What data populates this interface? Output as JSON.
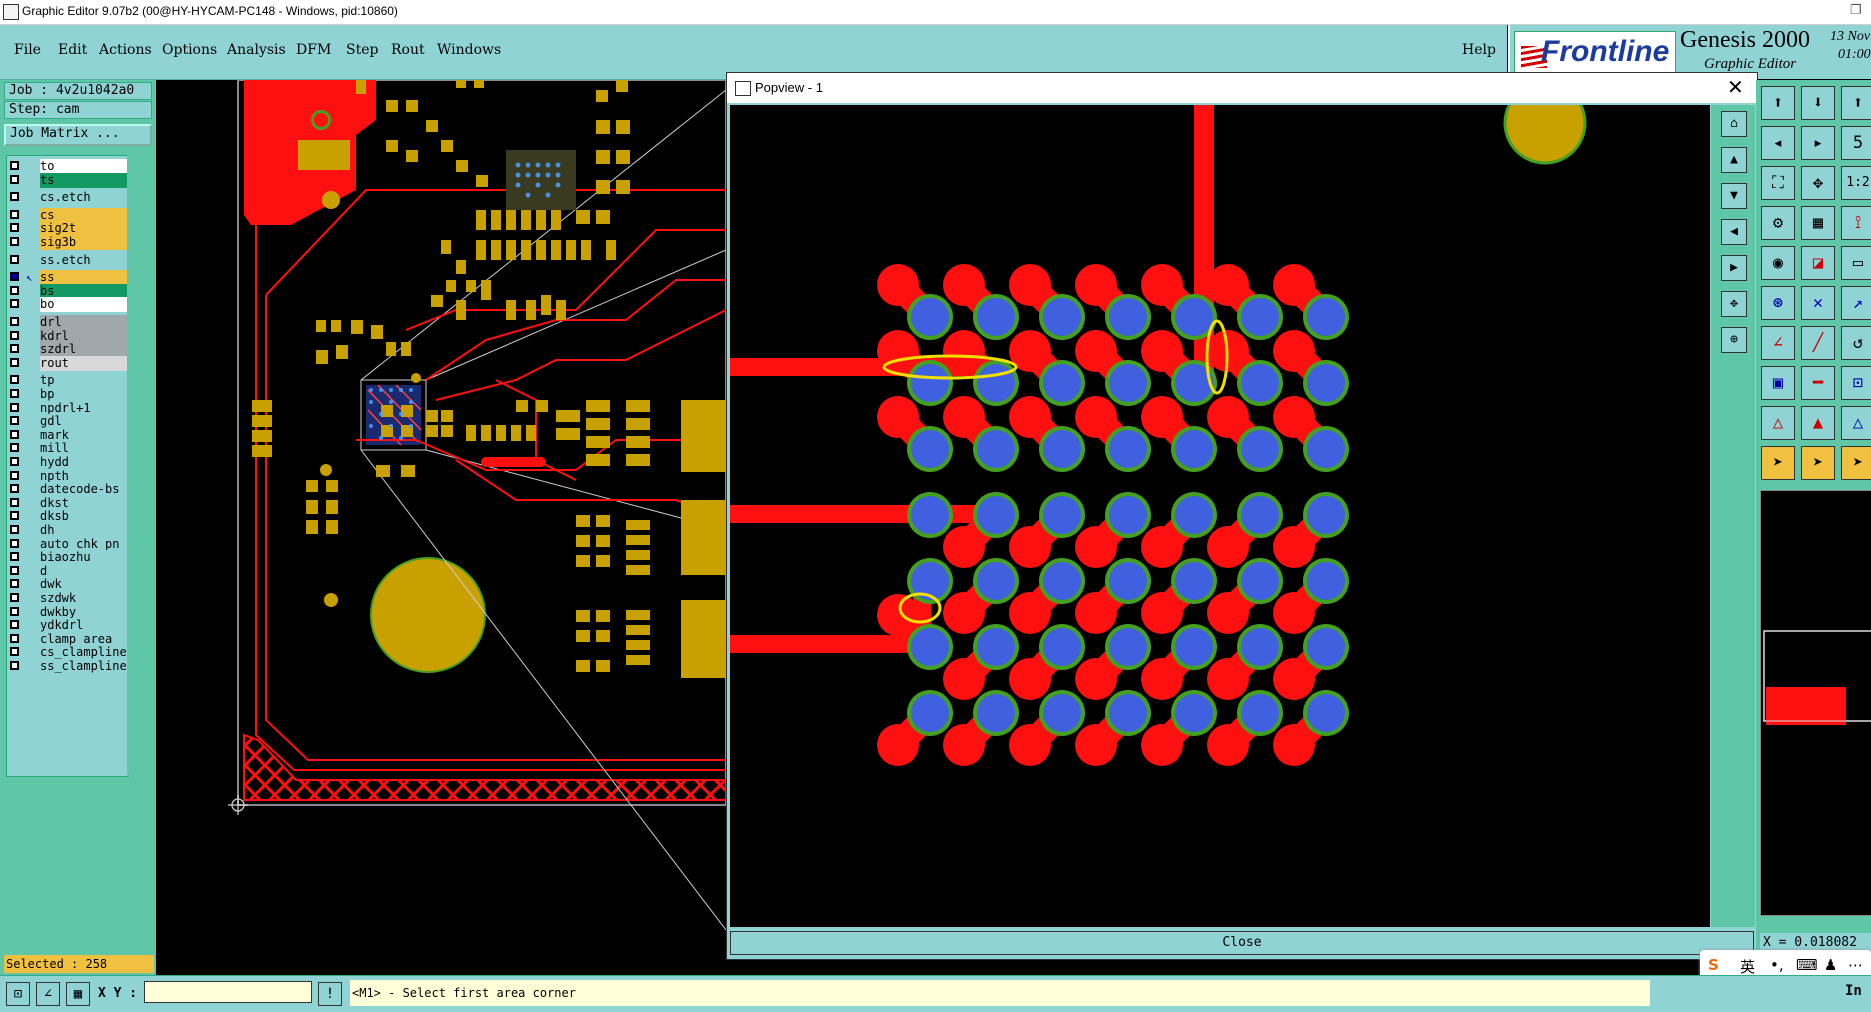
{
  "window": {
    "title": "Graphic Editor 9.07b2 (00@HY-HYCAM-PC148 - Windows, pid:10860)",
    "restore_glyph": "❐"
  },
  "menu": {
    "items": [
      "File",
      "Edit",
      "Actions",
      "Options",
      "Analysis",
      "DFM",
      "Step",
      "Rout",
      "Windows"
    ],
    "help": "Help"
  },
  "logo": {
    "brand": "Frontline",
    "product": "Genesis 2000",
    "subtitle": "Graphic Editor",
    "date": "13 Nov",
    "time": "01:00"
  },
  "left_panel": {
    "job": "Job : 4v2u1042a0",
    "step": "Step: cam",
    "job_matrix": "Job Matrix ...",
    "layers": [
      {
        "name": "to",
        "color": "#ffffff",
        "checked": false
      },
      {
        "name": "ts",
        "color": "#119a62",
        "checked": false
      },
      {
        "name": "cs.etch",
        "color": "#8fd3d5",
        "checked": false,
        "gap": true
      },
      {
        "name": "cs",
        "color": "#f0c040",
        "checked": false,
        "gap": true
      },
      {
        "name": "sig2t",
        "color": "#f0c040",
        "checked": false
      },
      {
        "name": "sig3b",
        "color": "#f0c040",
        "checked": false
      },
      {
        "name": "ss.etch",
        "color": "#8fd3d5",
        "checked": false,
        "gap": true
      },
      {
        "name": "ss",
        "color": "#f0c040",
        "checked": true,
        "active": true,
        "gap": true
      },
      {
        "name": "bs",
        "color": "#119a62",
        "checked": false
      },
      {
        "name": "bo",
        "color": "#ffffff",
        "checked": false
      },
      {
        "name": "drl",
        "color": "#a0a8ac",
        "checked": false,
        "gap": true
      },
      {
        "name": "kdrl",
        "color": "#a0a8ac",
        "checked": false
      },
      {
        "name": "szdrl",
        "color": "#a0a8ac",
        "checked": false
      },
      {
        "name": "rout",
        "color": "#d8d8d8",
        "checked": false
      },
      {
        "name": "tp",
        "color": "#8fd3d5",
        "checked": false,
        "gap": true
      },
      {
        "name": "bp",
        "color": "#8fd3d5",
        "checked": false
      },
      {
        "name": "npdrl+1",
        "color": "#8fd3d5",
        "checked": false
      },
      {
        "name": "gdl",
        "color": "#8fd3d5",
        "checked": false
      },
      {
        "name": "mark",
        "color": "#8fd3d5",
        "checked": false
      },
      {
        "name": "mill",
        "color": "#8fd3d5",
        "checked": false
      },
      {
        "name": "hydd",
        "color": "#8fd3d5",
        "checked": false
      },
      {
        "name": "npth",
        "color": "#8fd3d5",
        "checked": false
      },
      {
        "name": "datecode-bs",
        "color": "#8fd3d5",
        "checked": false
      },
      {
        "name": "dkst",
        "color": "#8fd3d5",
        "checked": false
      },
      {
        "name": "dksb",
        "color": "#8fd3d5",
        "checked": false
      },
      {
        "name": "dh",
        "color": "#8fd3d5",
        "checked": false
      },
      {
        "name": "auto_chk_pn",
        "color": "#8fd3d5",
        "checked": false
      },
      {
        "name": "biaozhu",
        "color": "#8fd3d5",
        "checked": false
      },
      {
        "name": "d",
        "color": "#8fd3d5",
        "checked": false
      },
      {
        "name": "dwk",
        "color": "#8fd3d5",
        "checked": false
      },
      {
        "name": "szdwk",
        "color": "#8fd3d5",
        "checked": false
      },
      {
        "name": "dwkby",
        "color": "#8fd3d5",
        "checked": false
      },
      {
        "name": "ydkdrl",
        "color": "#8fd3d5",
        "checked": false
      },
      {
        "name": "clamp_area",
        "color": "#8fd3d5",
        "checked": false
      },
      {
        "name": "cs_clampline",
        "color": "#8fd3d5",
        "checked": false
      },
      {
        "name": "ss_clampline",
        "color": "#8fd3d5",
        "checked": false
      }
    ],
    "selected": "Selected : 258"
  },
  "popview": {
    "title": "Popview - 1",
    "close_x": "✕",
    "close_label": "Close"
  },
  "bottom": {
    "xy_label": "X Y :",
    "xy_value": "",
    "status": "<M1> - Select first area corner",
    "excl": "!"
  },
  "right": {
    "x_readout": "X = 0.018082",
    "in_label": "In"
  },
  "ime": {
    "logo": "S",
    "lang": "英",
    "punct": "•,",
    "kbd": "⌨",
    "skin": "♟",
    "more": "⋯"
  },
  "colors": {
    "copper": "#c8a000",
    "trace": "#ff1010",
    "pad": "#4060e0",
    "mask": "#44a020",
    "panel": "#8fd3d5",
    "highlight": "#f0e000"
  }
}
